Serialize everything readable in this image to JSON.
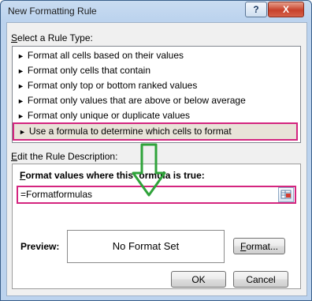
{
  "window": {
    "title": "New Formatting Rule",
    "help_label": "?",
    "close_label": "X"
  },
  "rule_type": {
    "heading_prefix": "S",
    "heading_rest": "elect a Rule Type:",
    "items": [
      {
        "label": "Format all cells based on their values"
      },
      {
        "label": "Format only cells that contain"
      },
      {
        "label": "Format only top or bottom ranked values"
      },
      {
        "label": "Format only values that are above or below average"
      },
      {
        "label": "Format only unique or duplicate values"
      },
      {
        "label": "Use a formula to determine which cells to format"
      }
    ],
    "arrow_glyph": "►",
    "selected_index": 5
  },
  "description": {
    "heading_prefix": "E",
    "heading_rest": "dit the Rule Description:",
    "formula_heading_prefix": "F",
    "formula_heading_part1": "ormat values where this ",
    "formula_heading_part2": "ormula is true:",
    "formula_value": "=Formatformulas",
    "preview_label": "Preview:",
    "preview_text": "No Format Set",
    "format_button_prefix": "F",
    "format_button_rest": "ormat..."
  },
  "buttons": {
    "ok_label": "OK",
    "cancel_label": "Cancel"
  },
  "colors": {
    "highlight_border": "#d4257f",
    "annotation_arrow": "#2fa33a"
  }
}
